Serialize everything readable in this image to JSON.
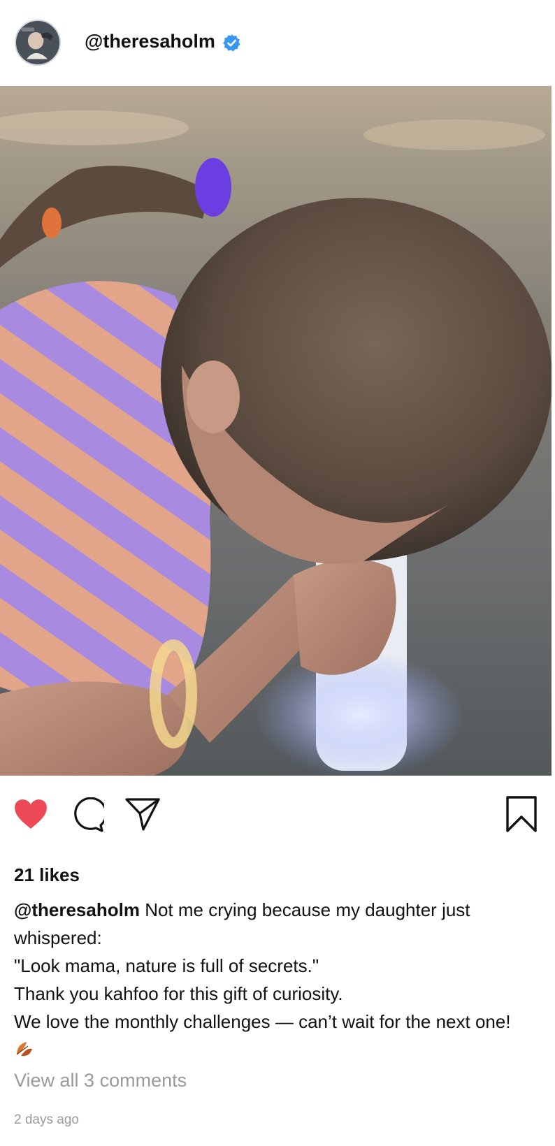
{
  "post": {
    "username": "@theresaholm",
    "verified": true,
    "likes_text": "21 likes",
    "caption": {
      "handle": "@theresaholm",
      "first_text": " Not me crying because my daughter just whispered:",
      "lines": [
        "\"Look mama, nature is full of secrets.\"",
        "Thank you kahfoo for this gift of curiosity.",
        "We love the monthly challenges — can’t wait for the next one!"
      ],
      "emoji": "fallen-leaf-emoji"
    },
    "view_comments": "View all 3 comments",
    "time": "2 days ago"
  },
  "actions": {
    "like_icon": "heart-icon",
    "comment_icon": "comment-icon",
    "share_icon": "paper-plane-icon",
    "save_icon": "bookmark-icon",
    "liked": true
  },
  "colors": {
    "like": "#ed4956",
    "verified": "#3897f0",
    "muted_text": "#9a9a9a"
  }
}
